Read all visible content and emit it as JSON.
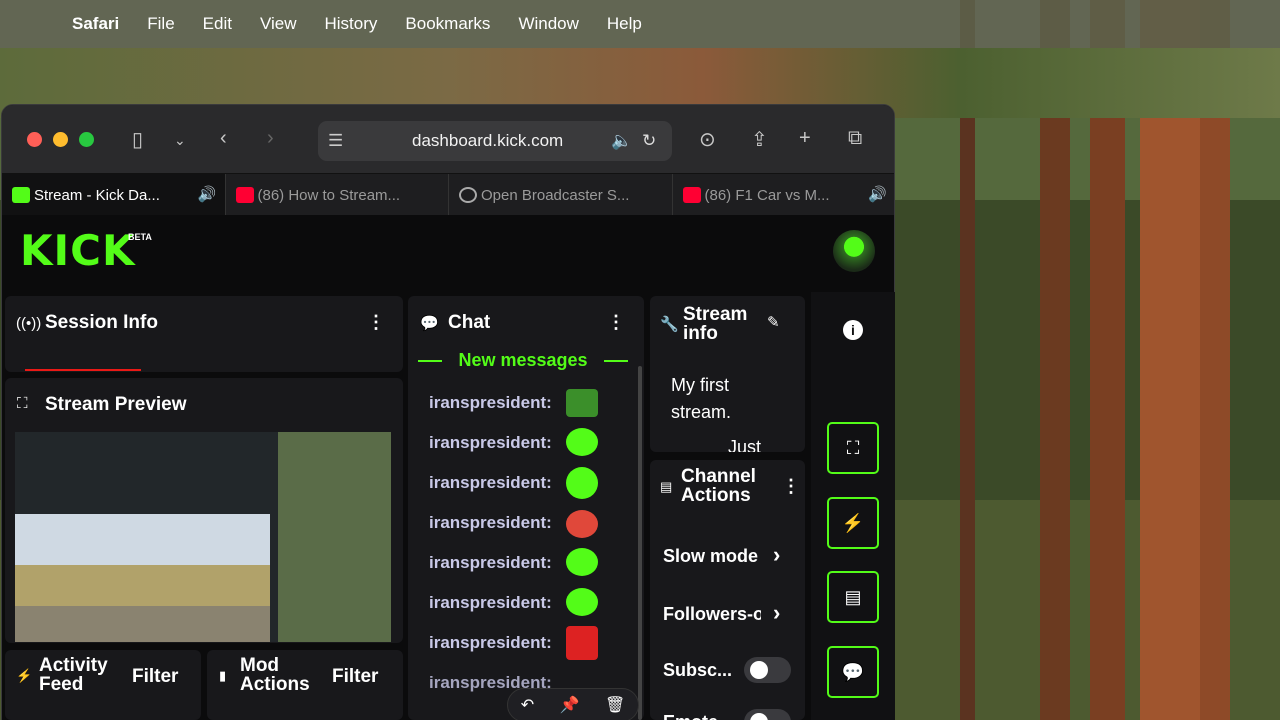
{
  "menubar": {
    "apple_icon": "apple-logo",
    "items": [
      "Safari",
      "File",
      "Edit",
      "View",
      "History",
      "Bookmarks",
      "Window",
      "Help"
    ]
  },
  "browser": {
    "url": "dashboard.kick.com",
    "tabs": [
      {
        "title": "Stream - Kick Da...",
        "favicon": "kick",
        "audio": true,
        "active": true
      },
      {
        "title": "(86) How to Stream...",
        "favicon": "youtube",
        "audio": false,
        "active": false
      },
      {
        "title": "Open Broadcaster S...",
        "favicon": "obs",
        "audio": false,
        "active": false
      },
      {
        "title": "(86) F1 Car vs M...",
        "favicon": "youtube",
        "audio": true,
        "active": false
      }
    ]
  },
  "kick": {
    "logo": "KICK",
    "beta": "BETA",
    "session_info": {
      "title": "Session Info"
    },
    "stream_preview": {
      "title": "Stream Preview"
    },
    "activity_feed": {
      "title_line1": "Activity",
      "title_line2": "Feed",
      "filter": "Filter"
    },
    "mod_actions": {
      "title_line1": "Mod",
      "title_line2": "Actions",
      "filter": "Filter"
    },
    "chat": {
      "title": "Chat",
      "new_messages": "New messages",
      "messages": [
        {
          "user": "iranspresident:"
        },
        {
          "user": "iranspresident:"
        },
        {
          "user": "iranspresident:"
        },
        {
          "user": "iranspresident:"
        },
        {
          "user": "iranspresident:"
        },
        {
          "user": "iranspresident:"
        },
        {
          "user": "iranspresident:"
        },
        {
          "user": "iranspresident:"
        }
      ]
    },
    "stream_info": {
      "title_line1": "Stream",
      "title_line2": "info",
      "title_text_line1": "My first",
      "title_text_line2": "stream.",
      "partial": "Just"
    },
    "channel_actions": {
      "title_line1": "Channel",
      "title_line2": "Actions",
      "items": [
        {
          "label": "Slow mode",
          "control": "chevron"
        },
        {
          "label": "Followers-o",
          "control": "chevron"
        },
        {
          "label": "Subsc...",
          "control": "toggle"
        },
        {
          "label": "Emote",
          "control": "toggle"
        }
      ]
    }
  },
  "colors": {
    "accent": "#53fc18",
    "panel": "#18181b",
    "page": "#0b0b0c"
  }
}
